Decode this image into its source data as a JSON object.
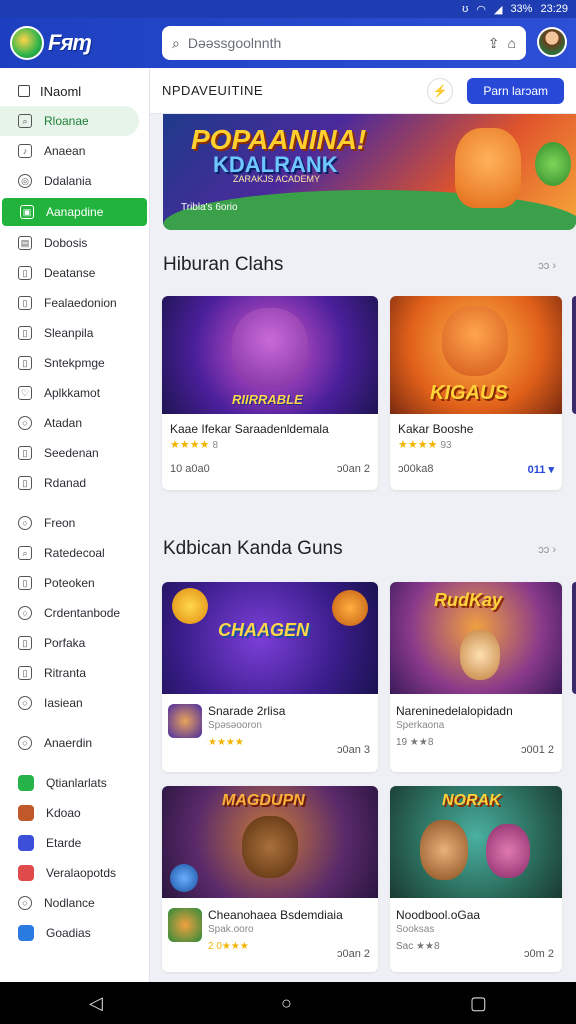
{
  "status": {
    "icons": [
      "ʊ",
      "wifi",
      "signal"
    ],
    "battery": "33%",
    "time": "23:29"
  },
  "app": {
    "logo_text": "Fᴙɱ",
    "search_placeholder": "Dəəssgoolnnth"
  },
  "sidebar": {
    "header": "INaoml",
    "items": [
      {
        "label": "Rloanae",
        "state": "hover",
        "icon": "search-icon"
      },
      {
        "label": "Anaean",
        "icon": "music-icon"
      },
      {
        "label": "Ddalania",
        "icon": "target-icon"
      },
      {
        "label": "Aanapdine",
        "state": "active",
        "icon": "bag-icon"
      },
      {
        "label": "Dobosis",
        "icon": "book-icon"
      },
      {
        "label": "Deatanse",
        "icon": "doc-icon"
      },
      {
        "label": "Fealaedonion",
        "icon": "doc-icon"
      },
      {
        "label": "Sleanpila",
        "icon": "doc-icon"
      },
      {
        "label": "Sntekpmge",
        "icon": "doc-icon"
      },
      {
        "label": "Aplkkamot",
        "icon": "heart-icon"
      },
      {
        "label": "Atadan",
        "icon": "circle-icon"
      },
      {
        "label": "Seedenan",
        "icon": "doc-icon"
      },
      {
        "label": "Rdanad",
        "icon": "doc-icon"
      },
      {
        "label": "Freon",
        "icon": "circle-icon",
        "gap": true
      },
      {
        "label": "Ratedecoal",
        "icon": "search-icon"
      },
      {
        "label": "Poteoken",
        "icon": "doc-icon"
      },
      {
        "label": "Crdentanbode",
        "icon": "circle-icon"
      },
      {
        "label": "Porfaka",
        "icon": "doc-icon"
      },
      {
        "label": "Ritranta",
        "icon": "doc-icon"
      },
      {
        "label": "Iasiean",
        "icon": "circle-icon"
      },
      {
        "label": "Anaerdin",
        "icon": "circle-icon",
        "gap": true
      },
      {
        "label": "Qtianlarlats",
        "icon": "green-app-icon",
        "color": "#26b34a",
        "gap": true
      },
      {
        "label": "Kdoao",
        "icon": "avatar-app-icon",
        "color": "#c0582a"
      },
      {
        "label": "Etarde",
        "icon": "blue-app-icon",
        "color": "#3b4fd8"
      },
      {
        "label": "Veralaopotds",
        "icon": "red-app-icon",
        "color": "#e04a4a"
      },
      {
        "label": "Nodlance",
        "icon": "circle-icon"
      },
      {
        "label": "Goadias",
        "icon": "lock-app-icon",
        "color": "#2a7be0"
      }
    ]
  },
  "main": {
    "topbar": {
      "title": "NPDAVEUITINE",
      "cta": "Parn larɔam"
    },
    "banner": {
      "line1": "POPAANINA!",
      "line2": "KDALRANK",
      "line3": "ZARAKJS ACADEMY",
      "caption": "Tribla's 6orio"
    },
    "section1": {
      "title": "Hiburan Clahs",
      "more": "ɔɔ ›",
      "cards": [
        {
          "art": "RIIRRABLE",
          "title": "Kaae Ifekar Saraadenldemala",
          "stars": "★★★★",
          "rating": "8",
          "left": "10 a0a0",
          "right": "ɔ0an 2"
        },
        {
          "art": "KIGAUS",
          "title": "Kakar Booshe",
          "stars": "★★★★",
          "rating": "93",
          "left": "ɔ00ka8",
          "right": "011 ▾"
        }
      ]
    },
    "section2": {
      "title": "Kdbican Kanda Guns",
      "more": "ɔɔ ›",
      "cards": [
        {
          "art": "CHAAGEN",
          "title": "Snarade 2rlisa",
          "sub": "Spəsəooron",
          "stars": "★★★★",
          "right": "ɔ0an 3"
        },
        {
          "art": "RudKay",
          "title": "Nareninedelalopidadn",
          "sub": "Sperkaona",
          "stars": "19 ★★8",
          "right": "ɔ001 2"
        },
        {
          "art": "MAGDUPN",
          "title": "Cheanohaea Bsdemdiaia",
          "sub": "Spak.ooro",
          "stars": "2 0★★★",
          "right": "ɔ0an 2"
        },
        {
          "art": "NORAK",
          "title": "Noodbool.oGaa",
          "sub": "Sooksas",
          "stars": "Sac ★★8",
          "right": "ɔ0m 2"
        }
      ]
    }
  },
  "navbar": {
    "back": "◁",
    "home": "○",
    "recents": "▢"
  },
  "colors": {
    "brand": "#2848d8",
    "active": "#22b33d",
    "star": "#f3b400"
  }
}
